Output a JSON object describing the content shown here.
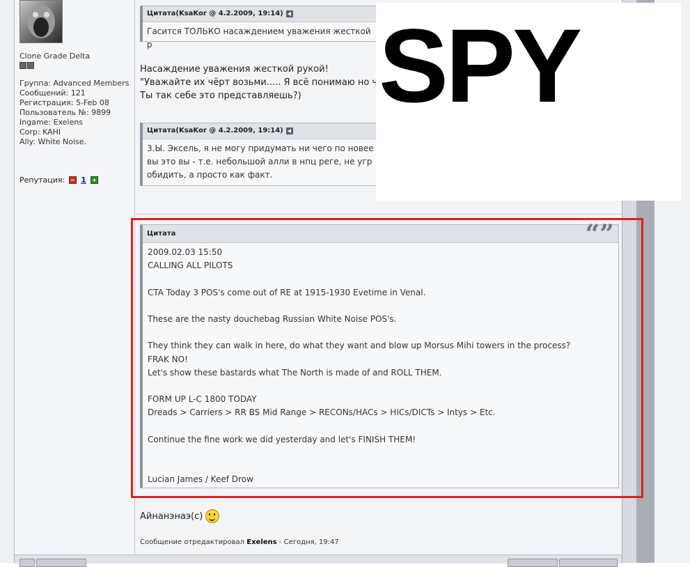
{
  "user": {
    "title": "Clone Grade Delta",
    "info": [
      "Группа: Advanced Members",
      "Сообщений: 121",
      "Регистрация: 5-Feb 08",
      "Пользователь №: 9899",
      "Ingame: Exelens",
      "Corp: KAHI",
      "Ally: White Noise."
    ],
    "reputation_label": "Репутация:",
    "reputation_value": "1"
  },
  "quote1": {
    "header": "Цитата(KsaKor @ 4.2.2009, 19:14)",
    "body": "Гасится ТОЛЬКО насаждением уважения жесткой р"
  },
  "post_text_1": [
    "Насаждение уважения жесткой рукой!",
    "\"Уважайте их чёрт возьми..... Я всё понимаю но чёр",
    "Ты так себе это представляешь?)"
  ],
  "quote2": {
    "header": "Цитата(KsaKor @ 4.2.2009, 19:14)",
    "body": [
      "3.Ы. Эксель, я не могу придумать ни чего по новее",
      "вы это вы - т.е. небольшой алли в нпц реге, не угр",
      "обидить, а просто как факт."
    ]
  },
  "overlay": {
    "spy_text": "SPY"
  },
  "big_quote": {
    "header": "Цитата",
    "quote_icon": "quote-mark-icon",
    "lines": [
      "2009.02.03 15:50",
      "CALLING ALL PILOTS",
      "",
      "CTA Today 3 POS's come out of RE at 1915-1930 Evetime in Venal.",
      "",
      "These are the nasty douchebag Russian White Noise POS's.",
      "",
      "They think they can walk in here, do what they want and blow up Morsus Mihi towers in the process?",
      "FRAK NO!",
      "Let's show these bastards what The North is made of and ROLL THEM.",
      "",
      "FORM UP L-C 1800 TODAY",
      "Dreads > Carriers > RR BS Mid Range > RECONs/HACs > HICs/DICTs > Intys > Etc.",
      "",
      "Continue the fine work we did yesterday and let's FINISH THEM!",
      "",
      "",
      "Lucian James / Keef Drow"
    ]
  },
  "reply": {
    "text": "Айнанэнаэ(с)",
    "smiley_icon": "smiley-icon"
  },
  "edited": {
    "prefix": "Сообщение отредактировал",
    "user": "Exelens",
    "suffix": "- Сегодня, 19:47"
  },
  "colors": {
    "highlight": "#e02020",
    "quote_header_bg": "#dfe2e7"
  }
}
